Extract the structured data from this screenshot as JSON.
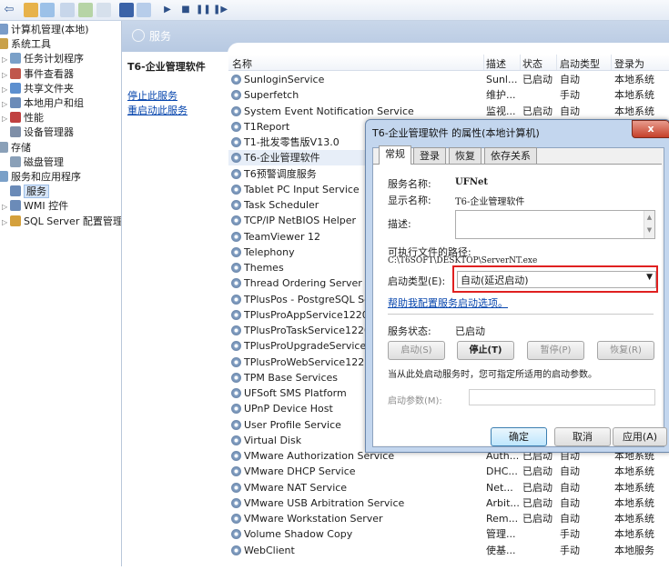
{
  "toolbar": {
    "icons": [
      "back-icon",
      "forward-icon",
      "up-icon",
      "show-hide-icon",
      "refresh-icon",
      "export-icon",
      "help-icon",
      "properties-icon",
      "start-icon",
      "stop-icon",
      "pause-icon",
      "restart-icon"
    ]
  },
  "tree": [
    {
      "label": "计算机管理(本地)",
      "indent": 0
    },
    {
      "label": "系统工具",
      "indent": 1
    },
    {
      "label": "任务计划程序",
      "indent": 2
    },
    {
      "label": "事件查看器",
      "indent": 2
    },
    {
      "label": "共享文件夹",
      "indent": 2
    },
    {
      "label": "本地用户和组",
      "indent": 2
    },
    {
      "label": "性能",
      "indent": 2
    },
    {
      "label": "设备管理器",
      "indent": 2
    },
    {
      "label": "存储",
      "indent": 0
    },
    {
      "label": "磁盘管理",
      "indent": 2
    },
    {
      "label": "服务和应用程序",
      "indent": 1
    },
    {
      "label": "服务",
      "indent": 2
    },
    {
      "label": "WMI 控件",
      "indent": 2
    },
    {
      "label": "SQL Server 配置管理器",
      "indent": 2
    }
  ],
  "header": {
    "title": "服务"
  },
  "desc": {
    "name": "T6-企业管理软件",
    "stop_link": "停止此服务",
    "restart_link": "重启动此服务"
  },
  "columns": {
    "name": "名称",
    "desc": "描述",
    "status": "状态",
    "startup": "启动类型",
    "logon": "登录为"
  },
  "services": [
    {
      "name": "SunloginService",
      "desc": "Sunl...",
      "status": "已启动",
      "startup": "自动",
      "logon": "本地系统"
    },
    {
      "name": "Superfetch",
      "desc": "维护...",
      "status": "",
      "startup": "手动",
      "logon": "本地系统"
    },
    {
      "name": "System Event Notification Service",
      "desc": "监视...",
      "status": "已启动",
      "startup": "自动",
      "logon": "本地系统"
    },
    {
      "name": "T1Report",
      "desc": "",
      "status": "",
      "startup": "",
      "logon": ""
    },
    {
      "name": "T1-批发零售版V13.0",
      "desc": "",
      "status": "",
      "startup": "",
      "logon": ""
    },
    {
      "name": "T6-企业管理软件",
      "desc": "",
      "status": "",
      "startup": "",
      "logon": ""
    },
    {
      "name": "T6预警调度服务",
      "desc": "",
      "status": "",
      "startup": "",
      "logon": ""
    },
    {
      "name": "Tablet PC Input Service",
      "desc": "",
      "status": "",
      "startup": "",
      "logon": ""
    },
    {
      "name": "Task Scheduler",
      "desc": "",
      "status": "",
      "startup": "",
      "logon": ""
    },
    {
      "name": "TCP/IP NetBIOS Helper",
      "desc": "",
      "status": "",
      "startup": "",
      "logon": ""
    },
    {
      "name": "TeamViewer 12",
      "desc": "",
      "status": "",
      "startup": "",
      "logon": ""
    },
    {
      "name": "Telephony",
      "desc": "",
      "status": "",
      "startup": "",
      "logon": ""
    },
    {
      "name": "Themes",
      "desc": "",
      "status": "",
      "startup": "",
      "logon": ""
    },
    {
      "name": "Thread Ordering Server",
      "desc": "",
      "status": "",
      "startup": "",
      "logon": ""
    },
    {
      "name": "TPlusPos - PostgreSQL Server",
      "desc": "",
      "status": "",
      "startup": "",
      "logon": ""
    },
    {
      "name": "TPlusProAppService1220",
      "desc": "",
      "status": "",
      "startup": "",
      "logon": ""
    },
    {
      "name": "TPlusProTaskService1220",
      "desc": "",
      "status": "",
      "startup": "",
      "logon": ""
    },
    {
      "name": "TPlusProUpgradeService1220",
      "desc": "",
      "status": "",
      "startup": "",
      "logon": ""
    },
    {
      "name": "TPlusProWebService1220",
      "desc": "",
      "status": "",
      "startup": "",
      "logon": ""
    },
    {
      "name": "TPM Base Services",
      "desc": "",
      "status": "",
      "startup": "",
      "logon": ""
    },
    {
      "name": "UFSoft SMS Platform",
      "desc": "",
      "status": "",
      "startup": "",
      "logon": ""
    },
    {
      "name": "UPnP Device Host",
      "desc": "",
      "status": "",
      "startup": "",
      "logon": ""
    },
    {
      "name": "User Profile Service",
      "desc": "",
      "status": "",
      "startup": "",
      "logon": ""
    },
    {
      "name": "Virtual Disk",
      "desc": "",
      "status": "",
      "startup": "",
      "logon": ""
    },
    {
      "name": "VMware Authorization Service",
      "desc": "Auth...",
      "status": "已启动",
      "startup": "自动",
      "logon": "本地系统"
    },
    {
      "name": "VMware DHCP Service",
      "desc": "DHC...",
      "status": "已启动",
      "startup": "自动",
      "logon": "本地系统"
    },
    {
      "name": "VMware NAT Service",
      "desc": "Net...",
      "status": "已启动",
      "startup": "自动",
      "logon": "本地系统"
    },
    {
      "name": "VMware USB Arbitration Service",
      "desc": "Arbit...",
      "status": "已启动",
      "startup": "自动",
      "logon": "本地系统"
    },
    {
      "name": "VMware Workstation Server",
      "desc": "Rem...",
      "status": "已启动",
      "startup": "自动",
      "logon": "本地系统"
    },
    {
      "name": "Volume Shadow Copy",
      "desc": "管理...",
      "status": "",
      "startup": "手动",
      "logon": "本地系统"
    },
    {
      "name": "WebClient",
      "desc": "使基...",
      "status": "",
      "startup": "手动",
      "logon": "本地服务"
    }
  ],
  "dialog": {
    "title": "T6-企业管理软件 的属性(本地计算机)",
    "close": "x",
    "tabs": [
      "常规",
      "登录",
      "恢复",
      "依存关系"
    ],
    "service_name_label": "服务名称:",
    "service_name": "UFNet",
    "display_name_label": "显示名称:",
    "display_name": "T6-企业管理软件",
    "description_label": "描述:",
    "path_label": "可执行文件的路径:",
    "path": "C:\\T6SOFT\\DESKTOP\\ServerNT.exe",
    "startup_type_label": "启动类型(E):",
    "startup_type": "自动(延迟启动)",
    "help_link": "帮助我配置服务启动选项。",
    "status_label": "服务状态:",
    "status": "已启动",
    "start_btn": "启动(S)",
    "stop_btn": "停止(T)",
    "pause_btn": "暂停(P)",
    "resume_btn": "恢复(R)",
    "hint": "当从此处启动服务时，您可指定所适用的启动参数。",
    "params_label": "启动参数(M):",
    "ok": "确定",
    "cancel": "取消",
    "apply": "应用(A)"
  },
  "colors": {
    "highlight": "#e02020",
    "accent": "#3c7fb1"
  }
}
